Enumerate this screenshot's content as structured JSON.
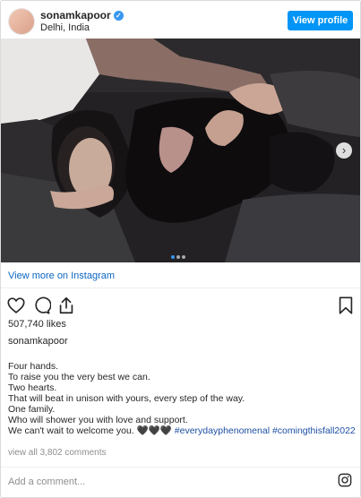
{
  "header": {
    "username": "sonamkapoor",
    "location": "Delhi, India",
    "view_profile_label": "View profile"
  },
  "post": {
    "view_more_label": "View more on Instagram",
    "likes": "507,740 likes",
    "caption_user": "sonamkapoor",
    "caption_lines": [
      "Four hands.",
      "To raise you the very best we can.",
      "Two hearts.",
      "That will beat in unison with yours, every step of the way.",
      "One family.",
      "Who will shower you with love and support."
    ],
    "last_line_text": "We can't wait to welcome you. ",
    "hearts": "🖤🖤🖤",
    "hashtags": [
      "#everydayphenomenal",
      "#comingthisfall2022"
    ],
    "comments_label": "view all 3,802 comments",
    "add_comment_placeholder": "Add a comment...",
    "carousel": {
      "total": 3,
      "active": 1
    }
  },
  "icons": [
    "verified-badge-icon",
    "chevron-right-icon",
    "heart-icon",
    "comment-icon",
    "share-icon",
    "bookmark-icon",
    "instagram-icon"
  ],
  "colors": {
    "accent": "#0095f6",
    "link": "#1d4fa3",
    "muted": "#8e8e8e"
  }
}
